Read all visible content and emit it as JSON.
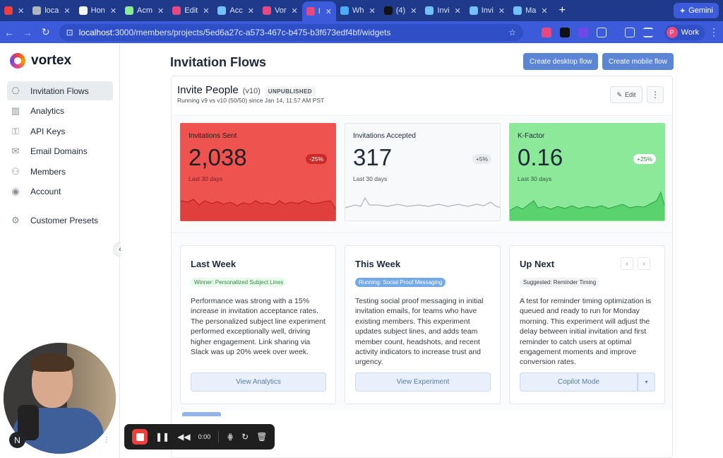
{
  "browser": {
    "tabs": [
      {
        "label": "",
        "color": "#f03e3e"
      },
      {
        "label": "loca",
        "color": "#adb5bd"
      },
      {
        "label": "Hon",
        "color": "#f8f9fa"
      },
      {
        "label": "Acm",
        "color": "#8ce99a"
      },
      {
        "label": "Edit",
        "color": "#e64980"
      },
      {
        "label": "Acc",
        "color": "#74c0fc"
      },
      {
        "label": "Vor",
        "color": "#e64980"
      },
      {
        "label": "I",
        "color": "#e64980"
      },
      {
        "label": "Wh",
        "color": "#4dabf7"
      },
      {
        "label": "(4)",
        "color": "#111111"
      },
      {
        "label": "Invi",
        "color": "#74c0fc"
      },
      {
        "label": "Invi",
        "color": "#74c0fc"
      },
      {
        "label": "Ma",
        "color": "#74c0fc"
      }
    ],
    "new_tab": "+",
    "gemini_label": "Gemini",
    "url_host": "localhost",
    "url_path": ":3000/members/projects/5ed6a27c-a573-467c-b475-b3f673edf4bf/widgets",
    "profile_initial": "P",
    "profile_label": "Work"
  },
  "sidebar": {
    "brand": "vortex",
    "items": [
      {
        "label": "Invitation Flows",
        "icon": "flow-icon",
        "glyph": "⎔"
      },
      {
        "label": "Analytics",
        "icon": "bar-chart-icon",
        "glyph": "▥"
      },
      {
        "label": "API Keys",
        "icon": "key-icon",
        "glyph": "⚿"
      },
      {
        "label": "Email Domains",
        "icon": "mail-icon",
        "glyph": "✉"
      },
      {
        "label": "Members",
        "icon": "users-icon",
        "glyph": "⚇"
      },
      {
        "label": "Account",
        "icon": "account-icon",
        "glyph": "◉"
      },
      {
        "label": "Customer Presets",
        "icon": "gear-icon",
        "glyph": "⚙"
      }
    ]
  },
  "page": {
    "title": "Invitation Flows",
    "create_desktop": "Create desktop flow",
    "create_mobile": "Create mobile flow"
  },
  "flow": {
    "name": "Invite People",
    "version": "(v10)",
    "status": "UNPUBLISHED",
    "subtitle": "Running v9 vs v10 (50/50) since Jan 14, 11:57 AM PST",
    "edit_label": "Edit",
    "more_label": "⋮"
  },
  "stats": [
    {
      "label": "Invitations Sent",
      "value": "2,038",
      "period": "Last 30 days",
      "change": "-25%",
      "color": "#ef5350"
    },
    {
      "label": "Invitations Accepted",
      "value": "317",
      "period": "Last 30 days",
      "change": "+5%",
      "color": "#f8f9fa"
    },
    {
      "label": "K-Factor",
      "value": "0.16",
      "period": "Last 30 days",
      "change": "+25%",
      "color": "#8ce99a"
    }
  ],
  "cards": {
    "last_week": {
      "title": "Last Week",
      "tag": "Winner: Personalized Subject Lines",
      "body": "Performance was strong with a 15% increase in invitation acceptance rates. The personalized subject line experiment performed exceptionally well, driving higher engagement. Link sharing via Slack was up 20% week over week.",
      "cta": "View Analytics"
    },
    "this_week": {
      "title": "This Week",
      "tag": "Running: Social Proof Messaging",
      "body": "Testing social proof messaging in initial invitation emails, for teams who have existing members. This experiment updates subject lines, and adds team member count, headshots, and recent activity indicators to increase trust and urgency.",
      "cta": "View Experiment"
    },
    "up_next": {
      "title": "Up Next",
      "tag": "Suggested: Reminder Timing",
      "body": "A test for reminder timing optimization is queued and ready to run for Monday morning. This experiment will adjust the delay between initial invitation and first reminder to catch users at optimal engagement moments and improve conversion rates.",
      "cta": "Copilot Mode",
      "prev": "‹",
      "next": "›",
      "caret": "▾"
    }
  },
  "recorder": {
    "time": "0:00",
    "cam_initial": "N"
  }
}
